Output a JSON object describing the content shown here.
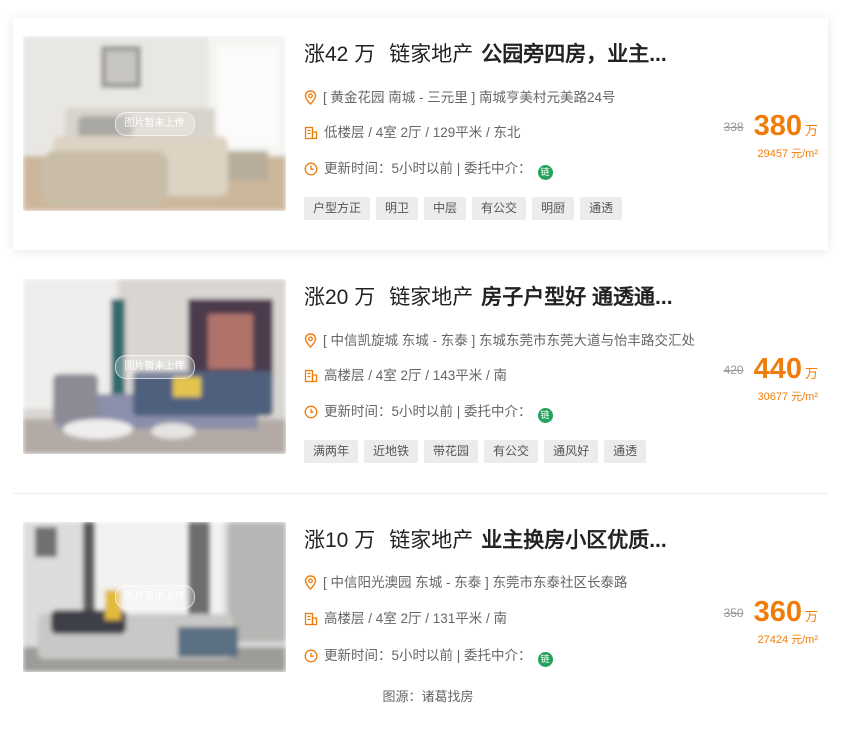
{
  "listings": [
    {
      "rise": "涨42 万",
      "agency": "链家地产",
      "headline": "公园旁四房，业主...",
      "image_badge": "图片暂未上传",
      "location": "[ 黄金花园 南城 - 三元里 ] 南城亨美村元美路24号",
      "layout": "低楼层 / 4室 2厅 / 129平米 / 东北",
      "update": "更新时间：5小时以前 | 委托中介：",
      "tags": [
        "户型方正",
        "明卫",
        "中层",
        "有公交",
        "明厨",
        "通透"
      ],
      "old_price": "338",
      "price": "380",
      "price_unit": "万",
      "unit_price": "29457 元/m²"
    },
    {
      "rise": "涨20 万",
      "agency": "链家地产",
      "headline": "房子户型好 通透通...",
      "image_badge": "图片暂未上传",
      "location": "[ 中信凯旋城 东城 - 东泰 ] 东城东莞市东莞大道与怡丰路交汇处",
      "layout": "高楼层 / 4室 2厅 / 143平米 / 南",
      "update": "更新时间：5小时以前 | 委托中介：",
      "tags": [
        "满两年",
        "近地铁",
        "带花园",
        "有公交",
        "通风好",
        "通透"
      ],
      "old_price": "420",
      "price": "440",
      "price_unit": "万",
      "unit_price": "30677 元/m²"
    },
    {
      "rise": "涨10 万",
      "agency": "链家地产",
      "headline": "业主换房小区优质...",
      "image_badge": "图片暂未上传",
      "location": "[ 中信阳光澳园 东城 - 东泰 ] 东莞市东泰社区长泰路",
      "layout": "高楼层 / 4室 2厅 / 131平米 / 南",
      "update": "更新时间：5小时以前 | 委托中介：",
      "tags": [],
      "old_price": "350",
      "price": "360",
      "price_unit": "万",
      "unit_price": "27424 元/m²"
    }
  ],
  "agent_badge": "链",
  "source": "图源：诸葛找房",
  "colors": {
    "price": "#f07c0b",
    "agent": "#25a35c",
    "tag_bg": "#ececec"
  },
  "icons": [
    "location-pin-icon",
    "building-icon",
    "clock-icon"
  ]
}
